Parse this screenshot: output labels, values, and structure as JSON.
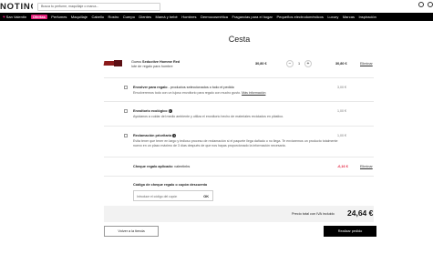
{
  "header": {
    "logo": "NOTINO",
    "search_placeholder": "Busca tu perfume, maquillaje o marca..."
  },
  "nav": {
    "items": [
      {
        "label": "San Valentín",
        "highlight": false
      },
      {
        "label": "Ofertas",
        "highlight": true
      },
      {
        "label": "Perfumes",
        "highlight": false
      },
      {
        "label": "Maquillaje",
        "highlight": false
      },
      {
        "label": "Cabello",
        "highlight": false
      },
      {
        "label": "Rostro",
        "highlight": false
      },
      {
        "label": "Cuerpo",
        "highlight": false
      },
      {
        "label": "Dientes",
        "highlight": false
      },
      {
        "label": "Mamá y bebé",
        "highlight": false
      },
      {
        "label": "Hombres",
        "highlight": false
      },
      {
        "label": "Dermocosmética",
        "highlight": false
      },
      {
        "label": "Fragancias para el hogar",
        "highlight": false
      },
      {
        "label": "Pequeños electrodomésticos",
        "highlight": false
      },
      {
        "label": "Luxury",
        "highlight": false
      },
      {
        "label": "Marcas",
        "highlight": false
      },
      {
        "label": "Inspiración",
        "highlight": false
      }
    ],
    "accent_color": "#e41f7b"
  },
  "page": {
    "title": "Cesta"
  },
  "product": {
    "brand": "Guess",
    "name": "Seductive Homme Red",
    "subtitle": "lote de regalo para hombre",
    "unit_price": "30,80 €",
    "quantity": "1",
    "minus": "−",
    "plus": "+",
    "line_price": "30,80 €",
    "remove_label": "Eliminar"
  },
  "options": [
    {
      "title": "Envolver para regalo",
      "title_suffix": " - productos seleccionados o todo el pedido",
      "desc": "Envolveremos todo con un lujoso envoltorio para regalo con mucho gusto.",
      "link": "Más información",
      "price": "3,00 €"
    },
    {
      "title": "Envoltorio ecológico",
      "desc": "Ayúdanos a cuidar del medio ambiente y utiliza el envoltorio hecho de materiales reciclados en plástico.",
      "price": "1,00 €"
    },
    {
      "title": "Reclamación prioritaria",
      "desc": "Evita tener que tener en largo y tedioso proceso de reclamación si el paquete llega dañado o no llega. Te enviaremos un producto totalmente nuevo en un plazo máximo de 3 días después de que nos hayas proporcionado la información necesaria.",
      "price": "1,00 €"
    }
  ],
  "gift_voucher": {
    "label": "Cheque regalo aplicado:",
    "code": "valentinbs",
    "amount": "-6,16 €",
    "remove_label": "Eliminar"
  },
  "coupon": {
    "label": "Código de cheque regalo o cupón descuento",
    "placeholder": "Introduce el código del cupón",
    "ok_label": "OK"
  },
  "total": {
    "label": "Precio total con IVA incluido",
    "value": "24,64 €"
  },
  "actions": {
    "back_label": "Volver a la tienda",
    "order_label": "Realizar pedido"
  }
}
